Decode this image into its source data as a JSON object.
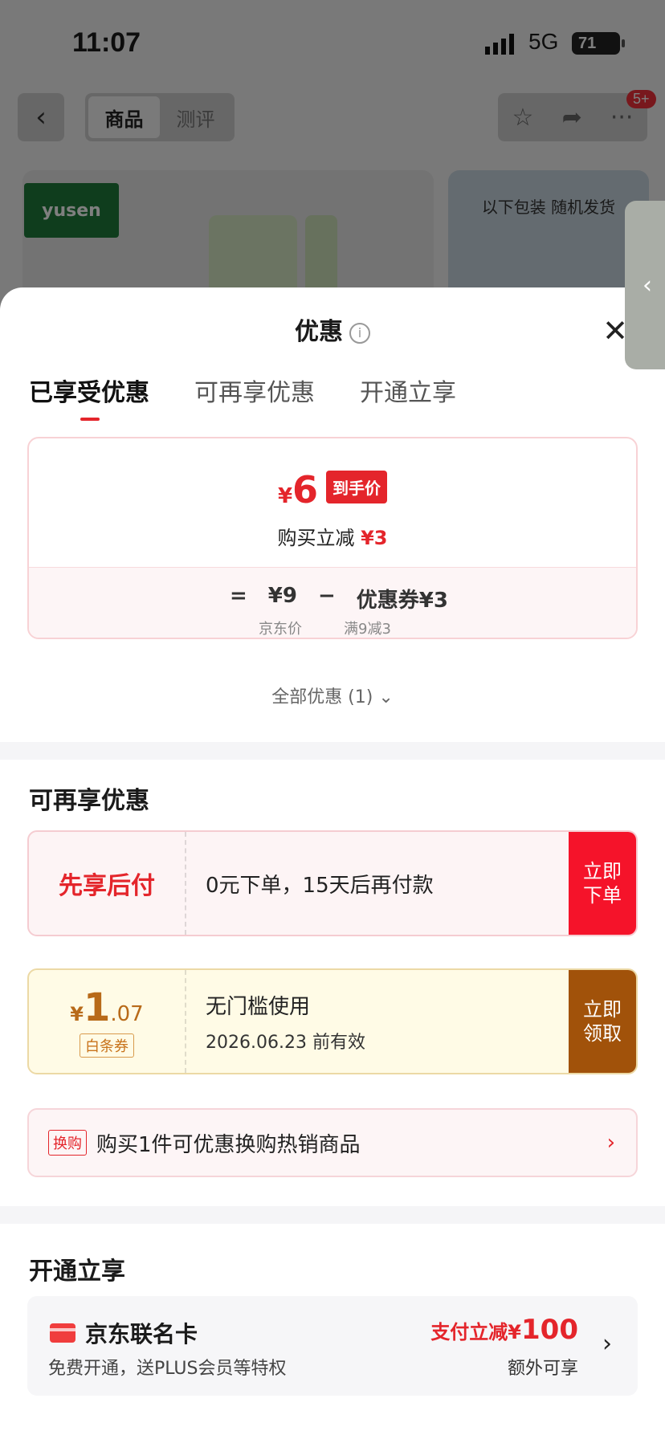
{
  "status": {
    "time": "11:07",
    "network": "5G",
    "battery": "71"
  },
  "nav": {
    "back": "‹",
    "tabs": [
      "商品",
      "测评"
    ],
    "badge": "5+"
  },
  "product": {
    "brand": "yusen",
    "thumb_text": "以下包装 随机发货"
  },
  "sheet": {
    "title": "优惠",
    "tabs": [
      "已享受优惠",
      "可再享优惠",
      "开通立享"
    ]
  },
  "price_card": {
    "final_price": "6",
    "currency": "¥",
    "final_tag": "到手价",
    "reduce_label": "购买立减",
    "reduce_amount": "¥3",
    "eq": "=",
    "jd_price": "¥9",
    "minus": "−",
    "coupon_label": "优惠券¥3",
    "jd_price_label": "京东价",
    "coupon_rule": "满9减3"
  },
  "all_link": "全部优惠 (1)",
  "extra_section": {
    "title": "可再享优惠",
    "pay_later": {
      "title": "先享后付",
      "desc": "0元下单，15天后再付款",
      "button": "立即\n下单"
    },
    "baitiao": {
      "symbol": "¥",
      "int": "1",
      "dec": ".07",
      "tag": "白条券",
      "line1": "无门槛使用",
      "line2": "2026.06.23 前有效",
      "button": "立即\n领取"
    },
    "swap": {
      "tag": "换购",
      "text": "购买1件可优惠换购热销商品"
    }
  },
  "open_section": {
    "title": "开通立享",
    "card": {
      "name": "京东联名卡",
      "desc": "免费开通，送PLUS会员等特权",
      "promo_label": "支付立减¥",
      "promo_amount": "100",
      "extra": "额外可享"
    }
  }
}
